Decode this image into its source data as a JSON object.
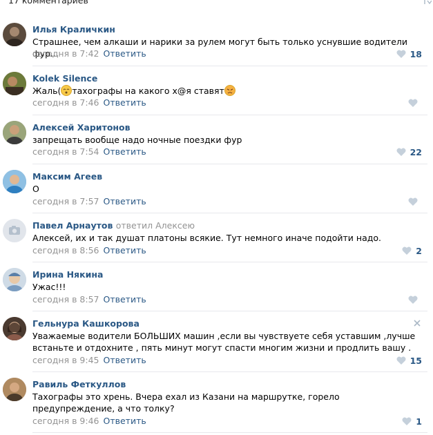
{
  "header": {
    "title": "17 комментариев"
  },
  "comments": [
    {
      "author": "Илья Краличкин",
      "replied": "",
      "text": "Страшнее, чем алкаши и нарики за рулем могут быть только уснувшие водители фур...",
      "time": "сегодня в 7:42",
      "reply_label": "Ответить",
      "likes": "18",
      "avatar_color": "#5b4b3d"
    },
    {
      "author": "Kolek Silence",
      "replied": "",
      "text_parts": [
        "Жаль(",
        "тахографы на какого х@я ставят"
      ],
      "time": "сегодня в 7:46",
      "reply_label": "Ответить",
      "likes": "",
      "avatar_color": "#7a5a3a"
    },
    {
      "author": "Алексей Харитонов",
      "replied": "",
      "text": "запрещать вообще надо ночные поездки фур",
      "time": "сегодня в 7:54",
      "reply_label": "Ответить",
      "likes": "22",
      "avatar_color": "#6b7a5a"
    },
    {
      "author": "Максим Агеев",
      "replied": "",
      "text": "О",
      "time": "сегодня в 7:57",
      "reply_label": "Ответить",
      "likes": "",
      "avatar_color": "#4a8fc2"
    },
    {
      "author": "Павел Арнаутов",
      "replied": "ответил Алексею",
      "text": "Алексей, их и так душат платоны всякие. Тут немного иначе подойти надо.",
      "time": "сегодня в 8:56",
      "reply_label": "Ответить",
      "likes": "2",
      "avatar_color": "#e1e5eb"
    },
    {
      "author": "Ирина Някина",
      "replied": "",
      "text": "Ужас!!!",
      "time": "сегодня в 8:57",
      "reply_label": "Ответить",
      "likes": "",
      "avatar_color": "#b9c9d8"
    },
    {
      "author": "Гельнура Кашкорова",
      "replied": "",
      "text": "Уважаемые водители БОЛЬШИХ машин ,если вы чувствуете себя уставшим ,лучше встаньте и отдохните , пять минут могут спасти многим жизни и продлить вашу .",
      "time": "сегодня в 9:45",
      "reply_label": "Ответить",
      "likes": "15",
      "avatar_color": "#6a4a3a"
    },
    {
      "author": "Равиль Феткуллов",
      "replied": "",
      "text": "Тахографы это хрень. Вчера ехал из Казани на маршрутке, горело предупреждение, а что толку?",
      "time": "сегодня в 9:46",
      "reply_label": "Ответить",
      "likes": "1",
      "avatar_color": "#8a6a4a"
    }
  ],
  "colors": {
    "link": "#2a5885",
    "meta": "#939393",
    "separator": "#e7e8ec",
    "heart_muted": "#c5d0db"
  }
}
